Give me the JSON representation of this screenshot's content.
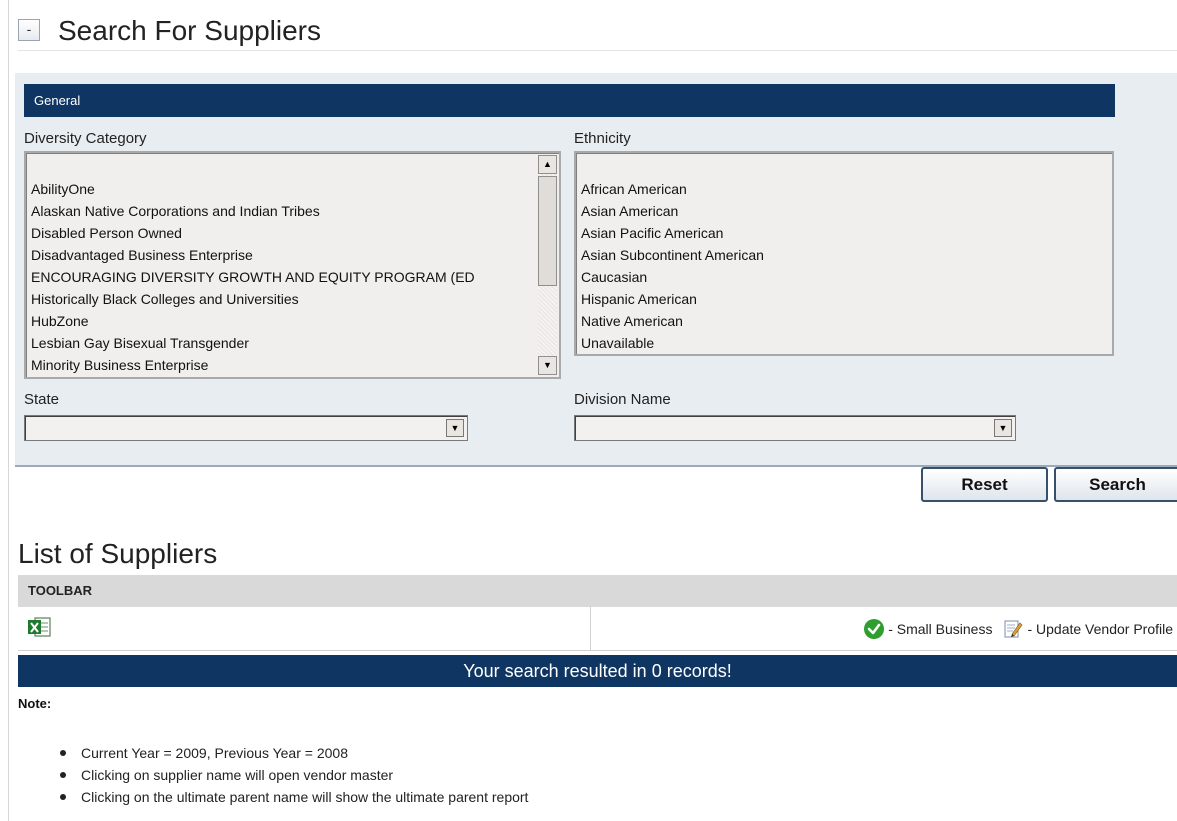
{
  "header": {
    "collapse_symbol": "-",
    "title": "Search For Suppliers"
  },
  "search_panel": {
    "section_title": "General",
    "diversity": {
      "label": "Diversity Category",
      "options": [
        "AbilityOne",
        "Alaskan Native Corporations and Indian Tribes",
        "Disabled Person Owned",
        "Disadvantaged Business Enterprise",
        "ENCOURAGING DIVERSITY GROWTH AND EQUITY PROGRAM (ED",
        "Historically Black Colleges and Universities",
        "HubZone",
        "Lesbian Gay Bisexual Transgender",
        "Minority Business Enterprise"
      ]
    },
    "ethnicity": {
      "label": "Ethnicity",
      "options": [
        "African American",
        "Asian American",
        "Asian Pacific American",
        "Asian Subcontinent American",
        "Caucasian",
        "Hispanic American",
        "Native American",
        "Unavailable"
      ]
    },
    "state": {
      "label": "State",
      "value": ""
    },
    "division": {
      "label": "Division Name",
      "value": ""
    },
    "reset_label": "Reset",
    "search_label": "Search"
  },
  "results": {
    "title": "List of Suppliers",
    "toolbar_label": "TOOLBAR",
    "legend_small_business": "- Small Business",
    "legend_update_profile": "- Update Vendor Profile",
    "summary": "Your search resulted in 0 records!",
    "note_label": "Note:",
    "notes": [
      "Current Year = 2009, Previous Year = 2008",
      "Clicking on supplier name will open vendor master",
      "Clicking on the ultimate parent name will show the ultimate parent report"
    ]
  },
  "colors": {
    "navy": "#0f3562",
    "panel_bg": "#e8edf2",
    "toolbar_bg": "#d9d9d9",
    "check_green": "#2e9e2e"
  },
  "icons": {
    "collapse": "minus-box-icon",
    "excel": "excel-export-icon",
    "small_business": "green-check-circle-icon",
    "update_profile": "edit-document-icon",
    "scroll_up": "triangle-up-icon",
    "scroll_down": "triangle-down-icon",
    "dropdown": "triangle-down-icon"
  }
}
